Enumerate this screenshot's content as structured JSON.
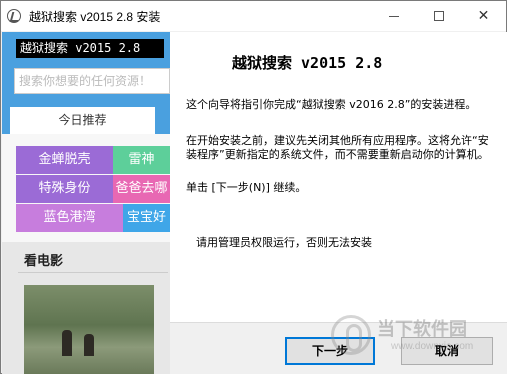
{
  "window": {
    "title": "越狱搜索 v2015 2.8 安装",
    "icon": "app-icon"
  },
  "banner": {
    "logo": "越狱搜索 v2015 2.8",
    "search_placeholder": "搜索你想要的任何资源！",
    "tab": "今日推荐",
    "tags": [
      "金蝉脱壳",
      "雷神",
      "特殊身份",
      "爸爸去哪",
      "蓝色港湾",
      "宝宝好"
    ],
    "section_title": "看电影"
  },
  "main": {
    "heading": "越狱搜索 v2015 2.8",
    "para1": "这个向导将指引你完成“越狱搜索 v2016 2.8”的安装进程。",
    "para2": "在开始安装之前，建议先关闭其他所有应用程序。这将允许“安装程序”更新指定的系统文件，而不需要重新启动你的计算机。",
    "para3": "单击 [下一步(N)] 继续。",
    "para4": "请用管理员权限运行，否则无法安装"
  },
  "buttons": {
    "next": "下一步",
    "cancel": "取消"
  },
  "watermark": {
    "text": "当下软件园",
    "url": "www.downxia.com"
  }
}
